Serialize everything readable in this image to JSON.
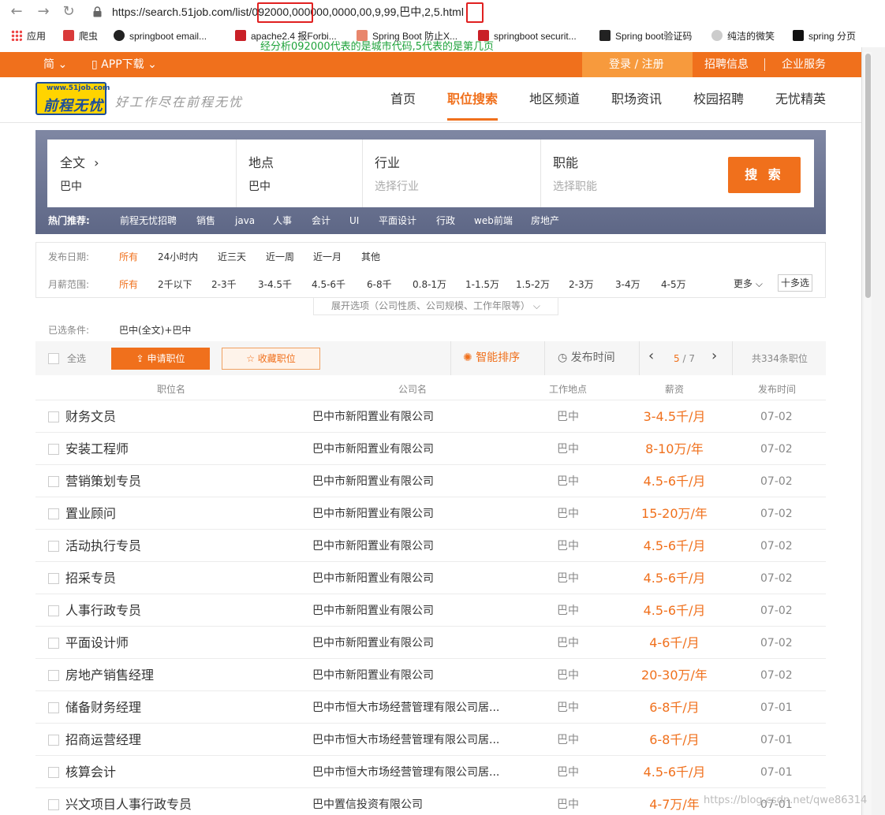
{
  "browser": {
    "url": "https://search.51job.com/list/092000,000000,0000,00,9,99,巴中,2,5.html",
    "annotation": "经分析092000代表的是城市代码,5代表的是第几页",
    "bookmarks": [
      "应用",
      "爬虫",
      "springboot email...",
      "apache2.4 报Forbi...",
      "Spring Boot 防止X...",
      "springboot securit...",
      "Spring boot验证码",
      "纯洁的微笑",
      "spring 分页"
    ]
  },
  "topbar": {
    "lang": "简 ⌄",
    "app": "APP下载 ⌄",
    "login": "登录 / 注册",
    "recruit": "招聘信息",
    "enterprise": "企业服务"
  },
  "header": {
    "logo_url": "www.51job.com",
    "logo_name": "前程无忧",
    "slogan": "好工作尽在前程无忧",
    "nav": [
      "首页",
      "职位搜索",
      "地区频道",
      "职场资讯",
      "校园招聘",
      "无忧精英"
    ]
  },
  "search": {
    "fulltext_label": "全文",
    "fulltext_value": "巴中",
    "location_label": "地点",
    "location_value": "巴中",
    "industry_label": "行业",
    "industry_placeholder": "选择行业",
    "function_label": "职能",
    "function_placeholder": "选择职能",
    "button": "搜 索",
    "hot_label": "热门推荐:",
    "hot": [
      "前程无忧招聘",
      "销售",
      "java",
      "人事",
      "会计",
      "UI",
      "平面设计",
      "行政",
      "web前端",
      "房地产"
    ]
  },
  "filters": {
    "date_label": "发布日期:",
    "date_options": [
      "所有",
      "24小时内",
      "近三天",
      "近一周",
      "近一月",
      "其他"
    ],
    "salary_label": "月薪范围:",
    "salary_options": [
      "所有",
      "2千以下",
      "2-3千",
      "3-4.5千",
      "4.5-6千",
      "6-8千",
      "0.8-1万",
      "1-1.5万",
      "1.5-2万",
      "2-3万",
      "3-4万",
      "4-5万"
    ],
    "more": "更多",
    "multi": "十多选",
    "expand": "展开选项（公司性质、公司规模、工作年限等）"
  },
  "selected": {
    "label": "已选条件:",
    "value": "巴中(全文)+巴中"
  },
  "toolbar": {
    "select_all": "全选",
    "apply": "申请职位",
    "save": "收藏职位",
    "smart_sort": "智能排序",
    "publish_time": "发布时间",
    "page_current": "5",
    "page_total": "/ 7",
    "total": "共334条职位"
  },
  "table": {
    "headers": [
      "职位名",
      "公司名",
      "工作地点",
      "薪资",
      "发布时间"
    ],
    "rows": [
      [
        "财务文员",
        "巴中市新阳置业有限公司",
        "巴中",
        "3-4.5千/月",
        "07-02"
      ],
      [
        "安装工程师",
        "巴中市新阳置业有限公司",
        "巴中",
        "8-10万/年",
        "07-02"
      ],
      [
        "营销策划专员",
        "巴中市新阳置业有限公司",
        "巴中",
        "4.5-6千/月",
        "07-02"
      ],
      [
        "置业顾问",
        "巴中市新阳置业有限公司",
        "巴中",
        "15-20万/年",
        "07-02"
      ],
      [
        "活动执行专员",
        "巴中市新阳置业有限公司",
        "巴中",
        "4.5-6千/月",
        "07-02"
      ],
      [
        "招采专员",
        "巴中市新阳置业有限公司",
        "巴中",
        "4.5-6千/月",
        "07-02"
      ],
      [
        "人事行政专员",
        "巴中市新阳置业有限公司",
        "巴中",
        "4.5-6千/月",
        "07-02"
      ],
      [
        "平面设计师",
        "巴中市新阳置业有限公司",
        "巴中",
        "4-6千/月",
        "07-02"
      ],
      [
        "房地产销售经理",
        "巴中市新阳置业有限公司",
        "巴中",
        "20-30万/年",
        "07-02"
      ],
      [
        "储备财务经理",
        "巴中市恒大市场经营管理有限公司居...",
        "巴中",
        "6-8千/月",
        "07-01"
      ],
      [
        "招商运营经理",
        "巴中市恒大市场经营管理有限公司居...",
        "巴中",
        "6-8千/月",
        "07-01"
      ],
      [
        "核算会计",
        "巴中市恒大市场经营管理有限公司居...",
        "巴中",
        "4.5-6千/月",
        "07-01"
      ],
      [
        "兴文项目人事行政专员",
        "巴中置信投资有限公司",
        "巴中",
        "4-7万/年",
        "07-01"
      ]
    ]
  },
  "watermark": "https://blog.csdn.net/qwe86314"
}
